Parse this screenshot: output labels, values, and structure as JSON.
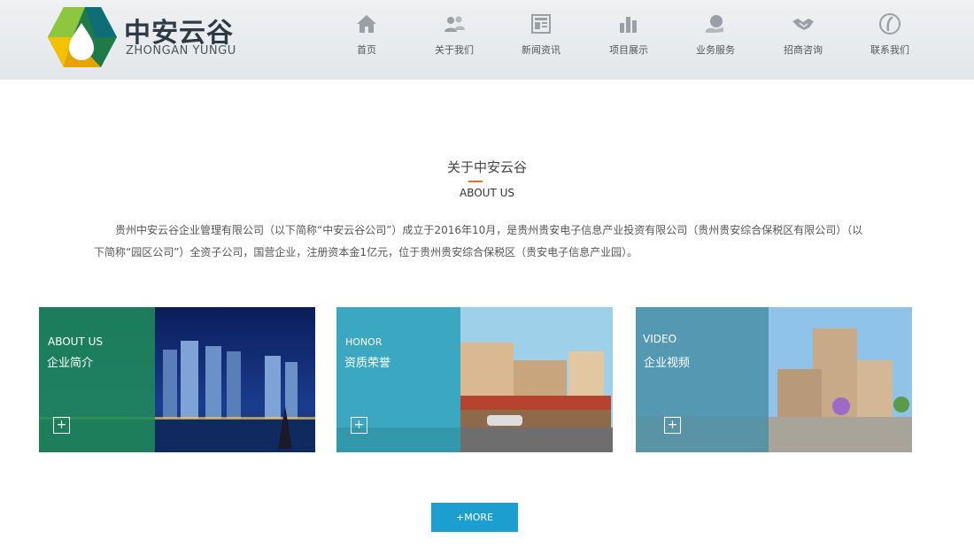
{
  "brand": {
    "name_cn": "中安云谷",
    "name_en": "ZHONGAN YUNGU"
  },
  "nav": [
    {
      "label": "首页",
      "icon": "home-icon"
    },
    {
      "label": "关于我们",
      "icon": "users-icon"
    },
    {
      "label": "新闻资讯",
      "icon": "newspaper-icon"
    },
    {
      "label": "项目展示",
      "icon": "bar-chart-icon"
    },
    {
      "label": "业务服务",
      "icon": "service-icon"
    },
    {
      "label": "招商咨询",
      "icon": "handshake-icon"
    },
    {
      "label": "联系我们",
      "icon": "phone-icon"
    }
  ],
  "about": {
    "title": "关于中安云谷",
    "subtitle": "ABOUT US",
    "intro": "贵州中安云谷企业管理有限公司（以下简称“中安云谷公司”）成立于2016年10月，是贵州贵安电子信息产业投资有限公司（贵州贵安综合保税区有限公司）（以下简称“园区公司”）全资子公司，国营企业，注册资本金1亿元，位于贵州贵安综合保税区（贵安电子信息产业园）。"
  },
  "cards": [
    {
      "en": "ABOUT US",
      "cn": "企业简介",
      "plus": "+"
    },
    {
      "en": "HONOR",
      "cn": "资质荣誉",
      "plus": "+"
    },
    {
      "en": "VIDEO",
      "cn": "企业视频",
      "plus": "+"
    }
  ],
  "more_label": "+MORE",
  "colors": {
    "accent_underline": "#e0722a",
    "more_button": "#1c9fcf",
    "card1_overlay": "#1f8a5b",
    "card2_overlay": "#2aa0b8",
    "card3_overlay": "#4a90a8"
  }
}
